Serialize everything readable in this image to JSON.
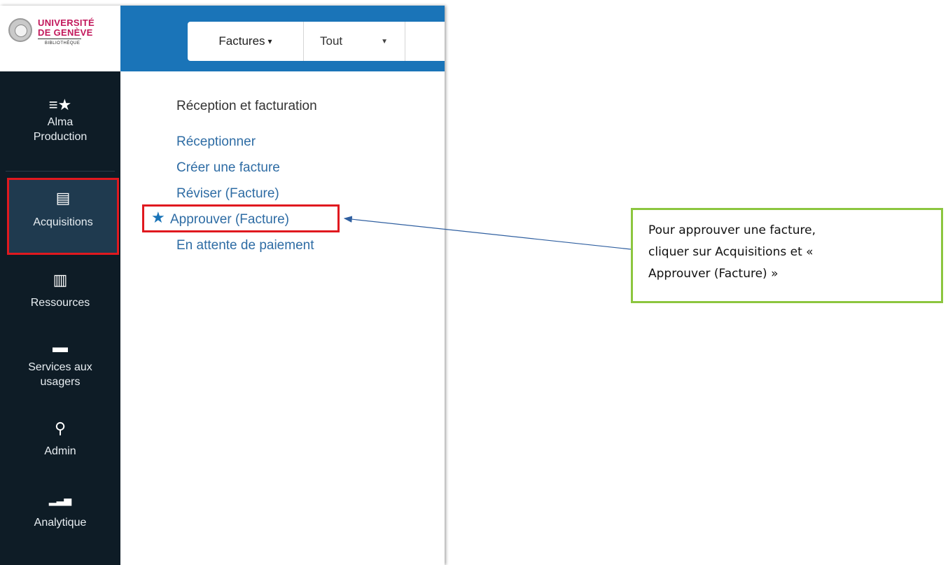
{
  "brand": {
    "line1": "UNIVERSITÉ",
    "line2": "DE GENÈVE",
    "line3": "BIBLIOTHÈQUE",
    "color": "#c2185b"
  },
  "sidebar": {
    "items": [
      {
        "icon": "list-star-icon",
        "glyph": "≡★",
        "label_line1": "Alma",
        "label_line2": "Production"
      },
      {
        "icon": "abacus-icon",
        "glyph": "▤",
        "label_line1": "Acquisitions",
        "label_line2": ""
      },
      {
        "icon": "books-icon",
        "glyph": "▥",
        "label_line1": "Ressources",
        "label_line2": ""
      },
      {
        "icon": "archive-box-icon",
        "glyph": "▬",
        "label_line1": "Services aux",
        "label_line2": "usagers"
      },
      {
        "icon": "key-icon",
        "glyph": "⚲",
        "label_line1": "Admin",
        "label_line2": ""
      },
      {
        "icon": "bar-chart-icon",
        "glyph": "▂▃▅",
        "label_line1": "Analytique",
        "label_line2": ""
      }
    ]
  },
  "search": {
    "scope_label": "Factures",
    "scope_caret": "▾",
    "filter_label": "Tout",
    "filter_caret": "▼"
  },
  "menu": {
    "title": "Réception et facturation",
    "links": [
      "Réceptionner",
      "Créer une facture",
      "Réviser (Facture)",
      "Approuver (Facture)",
      "En attente de paiement"
    ],
    "star": "★"
  },
  "callout": {
    "line1": "Pour approuver une facture,",
    "line2": "cliquer sur Acquisitions et «",
    "line3": "Approuver (Facture) »"
  },
  "colors": {
    "sidebar_bg": "#0e1c26",
    "topbar_bg": "#1a74b8",
    "highlight_border": "#e0191f",
    "callout_border": "#8cc63f",
    "link": "#2e6ca4",
    "arrow": "#2f5fa0"
  }
}
